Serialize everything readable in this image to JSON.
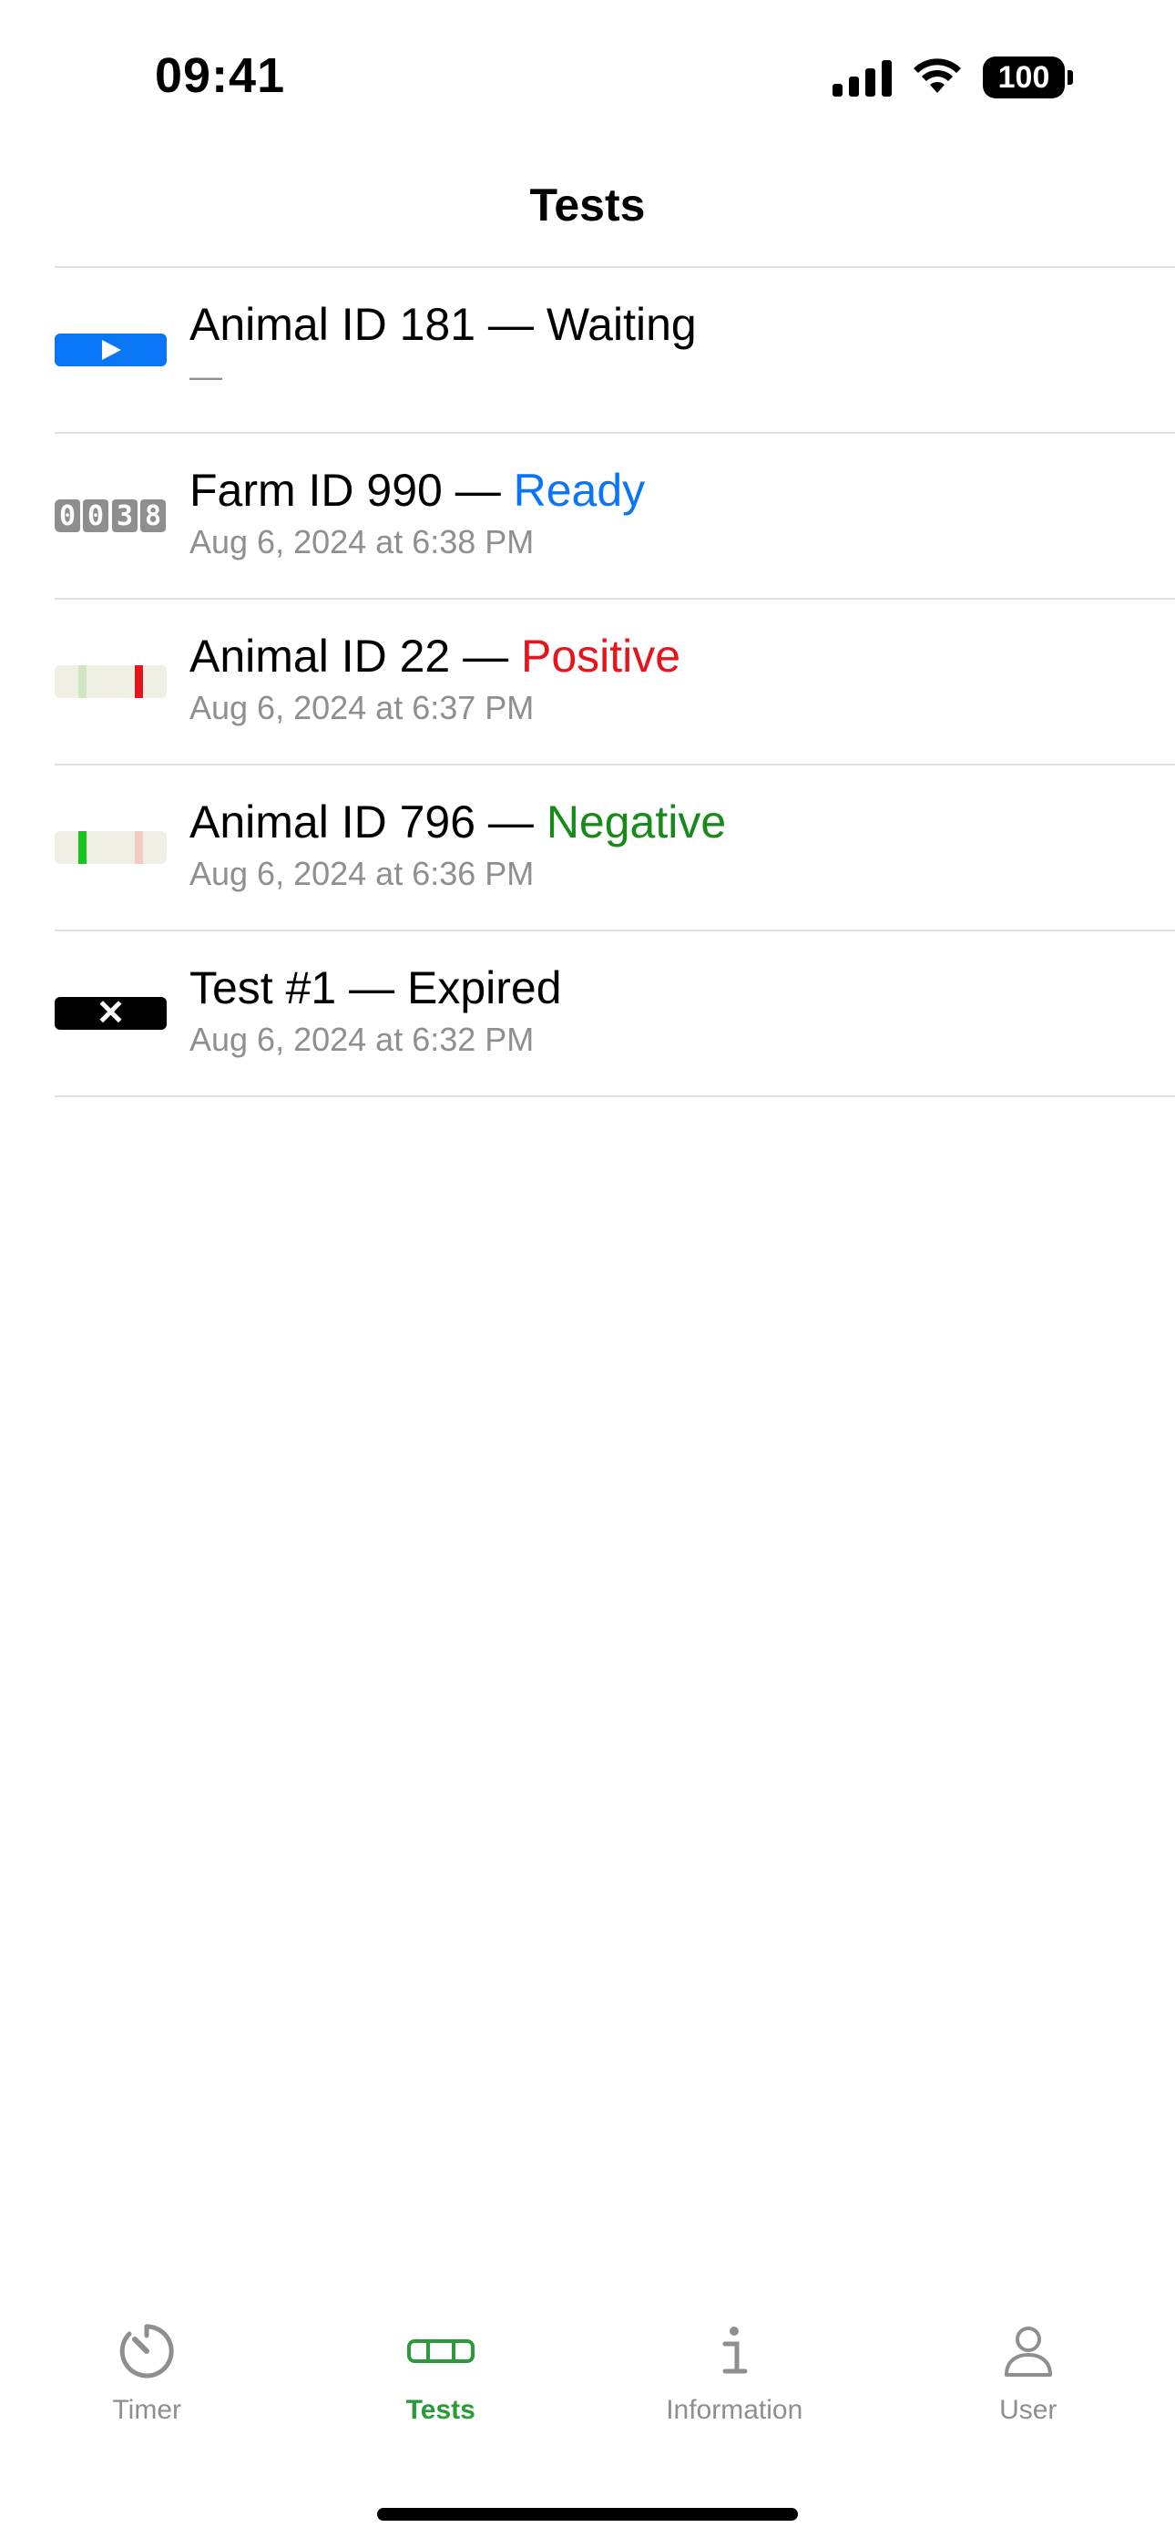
{
  "status_bar": {
    "time": "09:41",
    "battery": "100"
  },
  "nav": {
    "title": "Tests"
  },
  "colors": {
    "accent_green": "#2a9a3a",
    "ready_blue": "#0a76f5",
    "positive_red": "#e5151d",
    "negative_green": "#188a1a",
    "secondary_gray": "#8e8e93"
  },
  "tests": [
    {
      "title_prefix": "Animal ID 181 — ",
      "status": "Waiting",
      "subtitle": "—",
      "thumb": "play-icon"
    },
    {
      "title_prefix": "Farm ID 990 — ",
      "status": "Ready",
      "subtitle": "Aug 6, 2024 at 6:38 PM",
      "thumb": "countdown",
      "countdown": [
        "0",
        "0",
        "3",
        "8"
      ]
    },
    {
      "title_prefix": "Animal ID 22 — ",
      "status": "Positive",
      "subtitle": "Aug 6, 2024 at 6:37 PM",
      "thumb": "test-strip-positive"
    },
    {
      "title_prefix": "Animal ID 796 — ",
      "status": "Negative",
      "subtitle": "Aug 6, 2024 at 6:36 PM",
      "thumb": "test-strip-negative"
    },
    {
      "title_prefix": "Test #1 — ",
      "status": "Expired",
      "subtitle": "Aug 6, 2024 at 6:32 PM",
      "thumb": "close-icon",
      "thumb_glyph": "✕"
    }
  ],
  "tabs": [
    {
      "label": "Timer",
      "icon": "timer-icon",
      "active": false
    },
    {
      "label": "Tests",
      "icon": "test-strip-icon",
      "active": true
    },
    {
      "label": "Information",
      "icon": "info-icon",
      "active": false
    },
    {
      "label": "User",
      "icon": "person-icon",
      "active": false
    }
  ]
}
